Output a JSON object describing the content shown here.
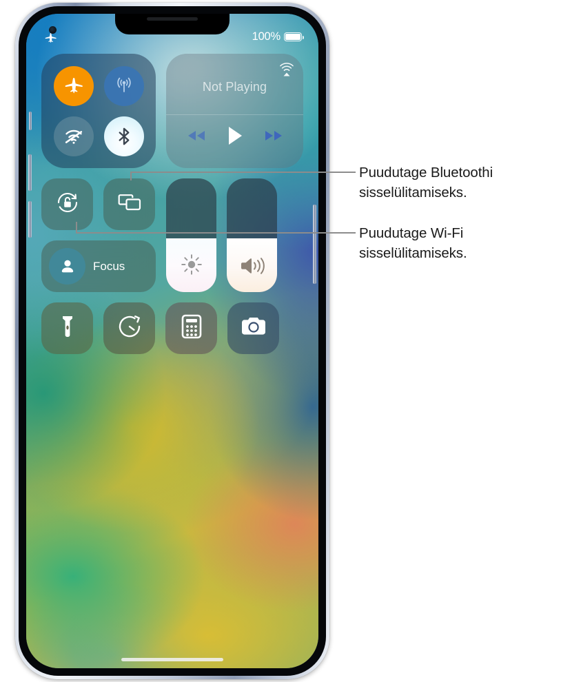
{
  "device": {
    "name": "iPhone",
    "status_bar": {
      "left_icon": "airplane-icon",
      "battery_percent": "100%",
      "battery_icon": "battery-full-icon"
    },
    "home_indicator": "home-indicator"
  },
  "control_center": {
    "connectivity": {
      "module_name": "connectivity-module",
      "buttons": [
        {
          "name": "airplane-mode-button",
          "icon": "airplane-icon",
          "state": "on",
          "color": "#f79400"
        },
        {
          "name": "cellular-data-button",
          "icon": "cellular-icon",
          "state": "on",
          "color": "#3a74b4"
        },
        {
          "name": "wifi-button",
          "icon": "wifi-off-icon",
          "state": "off",
          "color": "#809eaa"
        },
        {
          "name": "bluetooth-button",
          "icon": "bluetooth-icon",
          "state": "on",
          "color": "#ffffff"
        }
      ]
    },
    "media": {
      "module_name": "media-module",
      "title": "Not Playing",
      "airplay_icon": "airplay-icon",
      "controls": [
        {
          "name": "rewind-button",
          "icon": "rewind-icon"
        },
        {
          "name": "play-button",
          "icon": "play-icon"
        },
        {
          "name": "fast-forward-button",
          "icon": "fast-forward-icon"
        }
      ]
    },
    "tiles": [
      {
        "name": "rotation-lock-tile",
        "icon": "rotation-lock-icon"
      },
      {
        "name": "screen-mirroring-tile",
        "icon": "screen-mirroring-icon"
      }
    ],
    "focus": {
      "name": "focus-tile",
      "label": "Focus",
      "icon": "person-icon"
    },
    "sliders": [
      {
        "name": "brightness-slider",
        "icon": "brightness-icon",
        "level": 47
      },
      {
        "name": "volume-slider",
        "icon": "volume-icon",
        "level": 47
      }
    ],
    "shortcuts": [
      {
        "name": "flashlight-tile",
        "icon": "flashlight-icon"
      },
      {
        "name": "timer-tile",
        "icon": "timer-icon"
      },
      {
        "name": "calculator-tile",
        "icon": "calculator-icon"
      },
      {
        "name": "camera-tile",
        "icon": "camera-icon"
      }
    ]
  },
  "callouts": [
    {
      "name": "bluetooth-callout",
      "text": "Puudutage Bluetoothi\nsisselülitamiseks.",
      "target": "bluetooth-button"
    },
    {
      "name": "wifi-callout",
      "text": "Puudutage Wi-Fi\nsisselülitamiseks.",
      "target": "wifi-button"
    }
  ],
  "colors": {
    "callout_line": "#8c8c8c",
    "callout_text": "#1a1a1a",
    "accent_on": "#f79400",
    "page_background": "#ffffff"
  }
}
